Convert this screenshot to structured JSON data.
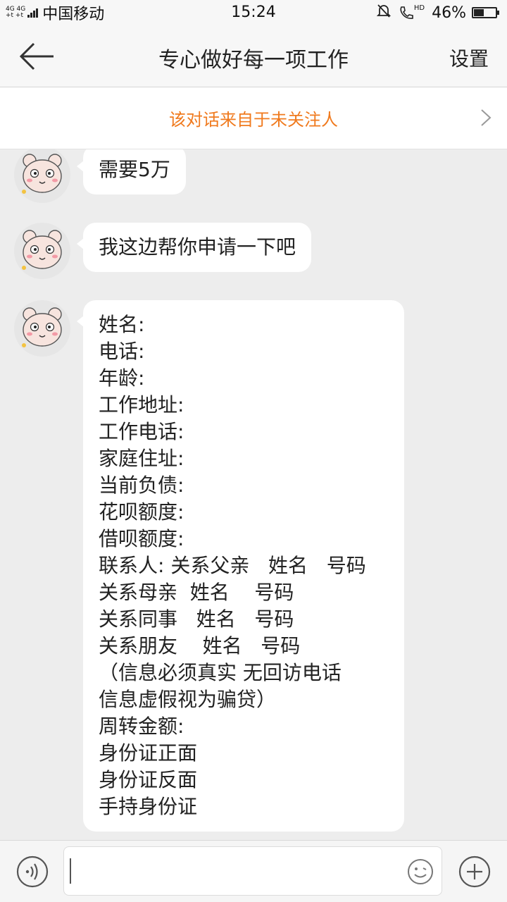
{
  "status_bar": {
    "network_tag_top": "4G 4G",
    "network_tag_bottom": "+t +t",
    "carrier": "中国移动",
    "time": "15:24",
    "hd_label": "HD",
    "battery_percent": "46%",
    "battery_level": 0.46,
    "icons": [
      "signal-icon",
      "mute-bell-icon",
      "hd-call-icon",
      "battery-icon"
    ]
  },
  "header": {
    "back_icon": "back-arrow-icon",
    "title": "专心做好每一项工作",
    "settings_label": "设置"
  },
  "notice": {
    "text": "该对话来自于未关注人",
    "chevron_icon": "chevron-right-icon"
  },
  "messages": [
    {
      "sender": "contact",
      "avatar_icon": "bear-avatar",
      "lines": [
        "需要5万"
      ]
    },
    {
      "sender": "contact",
      "avatar_icon": "bear-avatar",
      "lines": [
        "我这边帮你申请一下吧"
      ]
    },
    {
      "sender": "contact",
      "avatar_icon": "bear-avatar",
      "lines": [
        "姓名:",
        "电话:",
        "年龄:",
        "工作地址:",
        "工作电话:",
        "家庭住址:",
        "当前负债:",
        "花呗额度:",
        "借呗额度:",
        "联系人: 关系父亲   姓名   号码",
        "关系母亲  姓名    号码",
        "关系同事   姓名   号码",
        "关系朋友    姓名   号码",
        "（信息必须真实 无回访电话",
        "信息虚假视为骗贷）",
        "周转金额:",
        "身份证正面",
        "身份证反面",
        "手持身份证"
      ]
    }
  ],
  "input_bar": {
    "voice_icon": "voice-icon",
    "text_value": "",
    "emoji_icon": "emoji-icon",
    "plus_icon": "plus-icon"
  }
}
